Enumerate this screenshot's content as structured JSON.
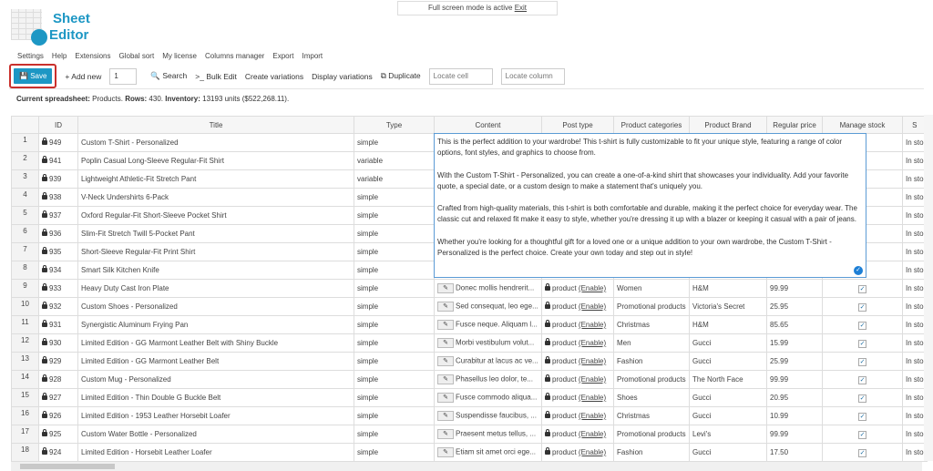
{
  "logo": {
    "line1": "Sheet",
    "line2": "Editor"
  },
  "fullscreen": {
    "text": "Full screen mode is active",
    "exit": "Exit"
  },
  "menu": [
    "Settings",
    "Help",
    "Extensions",
    "Global sort",
    "My license",
    "Columns manager",
    "Export",
    "Import"
  ],
  "toolbar": {
    "save": "Save",
    "add_new": "+ Add new",
    "add_count": "1",
    "search": "Search",
    "bulk_edit": ">_ Bulk Edit",
    "create_variations": "Create variations",
    "display_variations": "Display variations",
    "duplicate": "Duplicate",
    "locate_cell_placeholder": "Locate cell",
    "locate_column_placeholder": "Locate column"
  },
  "info": {
    "label": "Current spreadsheet:",
    "sheet": "Products.",
    "rows_label": "Rows:",
    "rows": "430.",
    "inv_label": "Inventory:",
    "inv": "13193 units ($522,268.11)."
  },
  "columns": [
    "",
    "ID",
    "Title",
    "Type",
    "Content",
    "Post type",
    "Product categories",
    "Product Brand",
    "Regular price",
    "Manage stock",
    "S"
  ],
  "rows": [
    {
      "n": "1",
      "id": "949",
      "title": "Custom T-Shirt - Personalized",
      "type": "simple",
      "stock": "In sto"
    },
    {
      "n": "2",
      "id": "941",
      "title": "Poplin Casual Long-Sleeve Regular-Fit Shirt",
      "type": "variable",
      "stock": "In sto"
    },
    {
      "n": "3",
      "id": "939",
      "title": "Lightweight Athletic-Fit Stretch Pant",
      "type": "variable",
      "stock": "In sto"
    },
    {
      "n": "4",
      "id": "938",
      "title": "V-Neck Undershirts 6-Pack",
      "type": "simple",
      "stock": "In sto"
    },
    {
      "n": "5",
      "id": "937",
      "title": "Oxford Regular-Fit Short-Sleeve Pocket Shirt",
      "type": "simple",
      "stock": "In sto"
    },
    {
      "n": "6",
      "id": "936",
      "title": "Slim-Fit Stretch Twill 5-Pocket Pant",
      "type": "simple",
      "stock": "In sto"
    },
    {
      "n": "7",
      "id": "935",
      "title": "Short-Sleeve Regular-Fit Print Shirt",
      "type": "simple",
      "stock": "In sto"
    },
    {
      "n": "8",
      "id": "934",
      "title": "Smart Silk Kitchen Knife",
      "type": "simple",
      "stock": "In sto"
    },
    {
      "n": "9",
      "id": "933",
      "title": "Heavy Duty Cast Iron Plate",
      "type": "simple",
      "content": "Donec mollis hendrerit...",
      "post_type": "product",
      "enable": "(Enable)",
      "cat": "Women",
      "brand": "H&M",
      "price": "99.99",
      "manage": true,
      "stock": "In sto"
    },
    {
      "n": "10",
      "id": "932",
      "title": "Custom Shoes - Personalized",
      "type": "simple",
      "content": "Sed consequat, leo ege...",
      "post_type": "product",
      "enable": "(Enable)",
      "cat": "Promotional products",
      "brand": "Victoria's Secret",
      "price": "25.95",
      "manage": true,
      "stock": "In sto"
    },
    {
      "n": "11",
      "id": "931",
      "title": "Synergistic Aluminum Frying Pan",
      "type": "simple",
      "content": "Fusce neque. Aliquam l...",
      "post_type": "product",
      "enable": "(Enable)",
      "cat": "Christmas",
      "brand": "H&M",
      "price": "85.65",
      "manage": true,
      "stock": "In sto"
    },
    {
      "n": "12",
      "id": "930",
      "title": "Limited Edition - GG Marmont Leather Belt with Shiny Buckle",
      "type": "simple",
      "content": "Morbi vestibulum volut...",
      "post_type": "product",
      "enable": "(Enable)",
      "cat": "Men",
      "brand": "Gucci",
      "price": "15.99",
      "manage": true,
      "stock": "In sto"
    },
    {
      "n": "13",
      "id": "929",
      "title": "Limited Edition - GG Marmont Leather Belt",
      "type": "simple",
      "content": "Curabitur at lacus ac ve...",
      "post_type": "product",
      "enable": "(Enable)",
      "cat": "Fashion",
      "brand": "Gucci",
      "price": "25.99",
      "manage": true,
      "stock": "In sto"
    },
    {
      "n": "14",
      "id": "928",
      "title": "Custom Mug - Personalized",
      "type": "simple",
      "content": "Phasellus leo dolor, te...",
      "post_type": "product",
      "enable": "(Enable)",
      "cat": "Promotional products",
      "brand": "The North Face",
      "price": "99.99",
      "manage": true,
      "stock": "In sto"
    },
    {
      "n": "15",
      "id": "927",
      "title": "Limited Edition - Thin Double G Buckle Belt",
      "type": "simple",
      "content": "Fusce commodo aliqua...",
      "post_type": "product",
      "enable": "(Enable)",
      "cat": "Shoes",
      "brand": "Gucci",
      "price": "20.95",
      "manage": true,
      "stock": "In sto"
    },
    {
      "n": "16",
      "id": "926",
      "title": "Limited Edition - 1953 Leather Horsebit Loafer",
      "type": "simple",
      "content": "Suspendisse faucibus, ...",
      "post_type": "product",
      "enable": "(Enable)",
      "cat": "Christmas",
      "brand": "Gucci",
      "price": "10.99",
      "manage": true,
      "stock": "In sto"
    },
    {
      "n": "17",
      "id": "925",
      "title": "Custom Water Bottle - Personalized",
      "type": "simple",
      "content": "Praesent metus tellus, ...",
      "post_type": "product",
      "enable": "(Enable)",
      "cat": "Promotional products",
      "brand": "Levi's",
      "price": "99.99",
      "manage": true,
      "stock": "In sto"
    },
    {
      "n": "18",
      "id": "924",
      "title": "Limited Edition - Horsebit Leather Loafer",
      "type": "simple",
      "content": "Etiam sit amet orci ege...",
      "post_type": "product",
      "enable": "(Enable)",
      "cat": "Fashion",
      "brand": "Gucci",
      "price": "17.50",
      "manage": true,
      "stock": "In sto"
    }
  ],
  "editor": {
    "paragraphs": [
      "This is the perfect addition to your wardrobe! This t-shirt is fully customizable to fit your unique style, featuring a range of color options, font styles, and graphics to choose from.",
      "With the Custom T-Shirt - Personalized, you can create a one-of-a-kind shirt that showcases your individuality. Add your favorite quote, a special date, or a custom design to make a statement that's uniquely you.",
      "Crafted from high-quality materials, this t-shirt is both comfortable and durable, making it the perfect choice for everyday wear. The classic cut and relaxed fit make it easy to style, whether you're dressing it up with a blazer or keeping it casual with a pair of jeans.",
      "Whether you're looking for a thoughtful gift for a loved one or a unique addition to your own wardrobe, the Custom T-Shirt - Personalized is the perfect choice. Create your own today and step out in style!"
    ]
  },
  "colors": {
    "accent": "#1d97c4",
    "highlight": "#c9302c"
  }
}
